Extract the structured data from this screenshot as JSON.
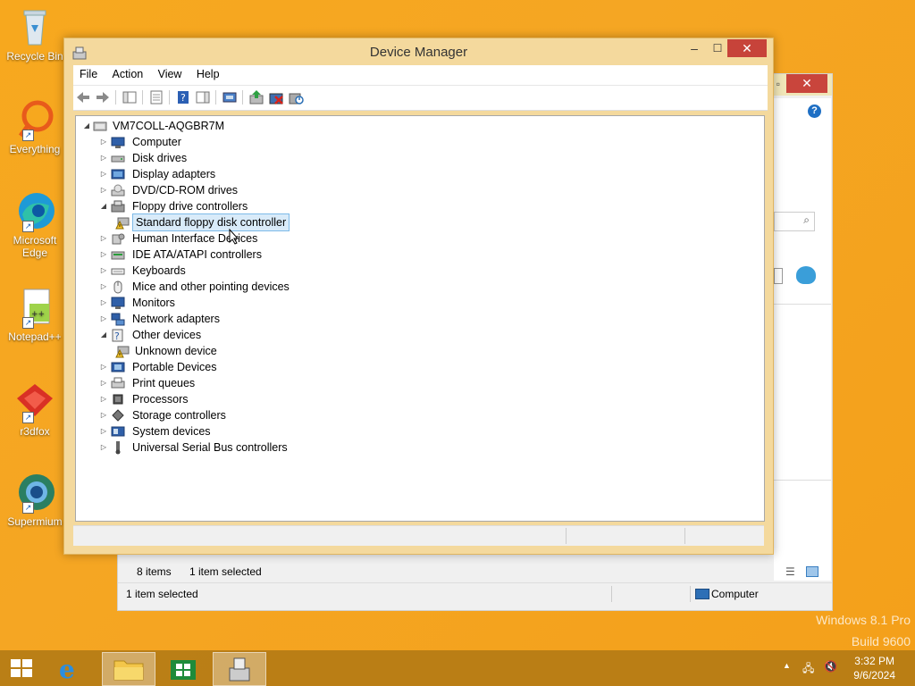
{
  "desktop": {
    "icons": [
      {
        "label": "Recycle Bin"
      },
      {
        "label": "Everything"
      },
      {
        "label": "Microsoft\nEdge"
      },
      {
        "label": "Notepad++"
      },
      {
        "label": "r3dfox"
      },
      {
        "label": "Supermium"
      }
    ],
    "watermark_line1": "Windows 8.1 Pro",
    "watermark_line2": "Build 9600"
  },
  "background_window": {
    "status_items": "8 items",
    "status_selected": "1 item selected",
    "bottom_selected": "1 item selected",
    "bottom_location": "Computer"
  },
  "device_manager": {
    "title": "Device Manager",
    "menu": [
      "File",
      "Action",
      "View",
      "Help"
    ],
    "root": "VM7COLL-AQGBR7M",
    "tree": [
      {
        "label": "Computer",
        "state": "collapsed",
        "icon": "computer-icon"
      },
      {
        "label": "Disk drives",
        "state": "collapsed",
        "icon": "disk-drive-icon"
      },
      {
        "label": "Display adapters",
        "state": "collapsed",
        "icon": "display-adapter-icon"
      },
      {
        "label": "DVD/CD-ROM drives",
        "state": "collapsed",
        "icon": "dvd-icon"
      },
      {
        "label": "Floppy drive controllers",
        "state": "expanded",
        "icon": "floppy-controller-icon"
      },
      {
        "label": "Standard floppy disk controller",
        "state": "child-selected",
        "icon": "warning-device-icon"
      },
      {
        "label": "Human Interface Devices",
        "state": "collapsed",
        "icon": "hid-icon"
      },
      {
        "label": "IDE ATA/ATAPI controllers",
        "state": "collapsed",
        "icon": "ide-icon"
      },
      {
        "label": "Keyboards",
        "state": "collapsed",
        "icon": "keyboard-icon"
      },
      {
        "label": "Mice and other pointing devices",
        "state": "collapsed",
        "icon": "mouse-icon"
      },
      {
        "label": "Monitors",
        "state": "collapsed",
        "icon": "monitor-icon"
      },
      {
        "label": "Network adapters",
        "state": "collapsed",
        "icon": "network-icon"
      },
      {
        "label": "Other devices",
        "state": "expanded",
        "icon": "other-devices-icon"
      },
      {
        "label": "Unknown device",
        "state": "child",
        "icon": "warning-device-icon"
      },
      {
        "label": "Portable Devices",
        "state": "collapsed",
        "icon": "portable-icon"
      },
      {
        "label": "Print queues",
        "state": "collapsed",
        "icon": "printer-icon"
      },
      {
        "label": "Processors",
        "state": "collapsed",
        "icon": "processor-icon"
      },
      {
        "label": "Storage controllers",
        "state": "collapsed",
        "icon": "storage-icon"
      },
      {
        "label": "System devices",
        "state": "collapsed",
        "icon": "system-icon"
      },
      {
        "label": "Universal Serial Bus controllers",
        "state": "collapsed",
        "icon": "usb-icon"
      }
    ]
  },
  "taskbar": {
    "time": "3:32 PM",
    "date": "9/6/2024"
  },
  "colors": {
    "desktop": "#f5a623",
    "window_frame": "#f4d99d",
    "close_button": "#c7433a",
    "selection": "#d9ebf9"
  }
}
